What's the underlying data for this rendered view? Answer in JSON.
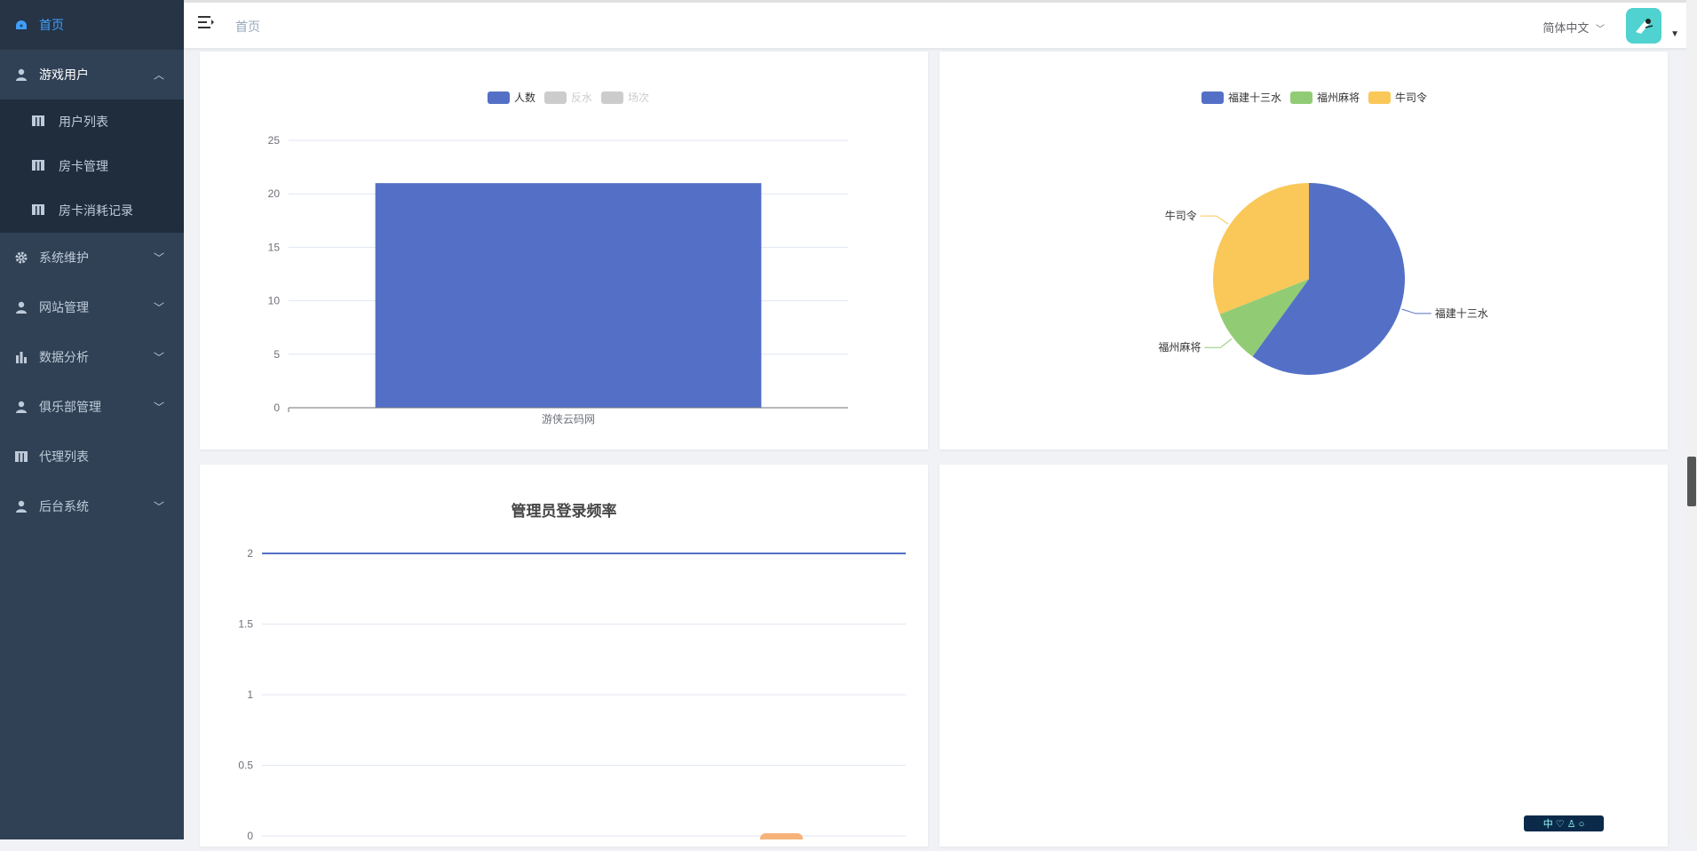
{
  "sidebar": {
    "home": "首页",
    "game_users": "游戏用户",
    "sub_items": [
      "用户列表",
      "房卡管理",
      "房卡消耗记录"
    ],
    "items": [
      "系统维护",
      "网站管理",
      "数据分析",
      "俱乐部管理",
      "代理列表",
      "后台系统"
    ]
  },
  "header": {
    "breadcrumb": "首页",
    "language": "简体中文"
  },
  "bar_chart": {
    "chart_data": {
      "type": "bar",
      "legend": [
        "人数",
        "反水",
        "场次"
      ],
      "categories": [
        "游侠云码网"
      ],
      "series": [
        {
          "name": "人数",
          "values": [
            21
          ]
        }
      ],
      "ylim": [
        0,
        25
      ],
      "yticks": [
        "0",
        "5",
        "10",
        "15",
        "20",
        "25"
      ],
      "colors": {
        "人数": "#5470c6",
        "disabled": "#cccccc"
      }
    }
  },
  "pie_chart": {
    "chart_data": {
      "type": "pie",
      "legend": [
        "福建十三水",
        "福州麻将",
        "牛司令"
      ],
      "slices": [
        {
          "name": "福建十三水",
          "value": 60,
          "color": "#5470c6"
        },
        {
          "name": "福州麻将",
          "value": 9,
          "color": "#91cc75"
        },
        {
          "name": "牛司令",
          "value": 31,
          "color": "#fac858"
        }
      ]
    }
  },
  "line_chart": {
    "chart_data": {
      "type": "line",
      "title": "管理员登录频率",
      "series": [
        {
          "values": [
            2,
            2
          ]
        }
      ],
      "ylim": [
        0,
        2
      ],
      "yticks": [
        "0",
        "0.5",
        "1",
        "1.5",
        "2"
      ],
      "color": "#5470c6"
    }
  },
  "badge": "中 ♡ ♙ ○"
}
